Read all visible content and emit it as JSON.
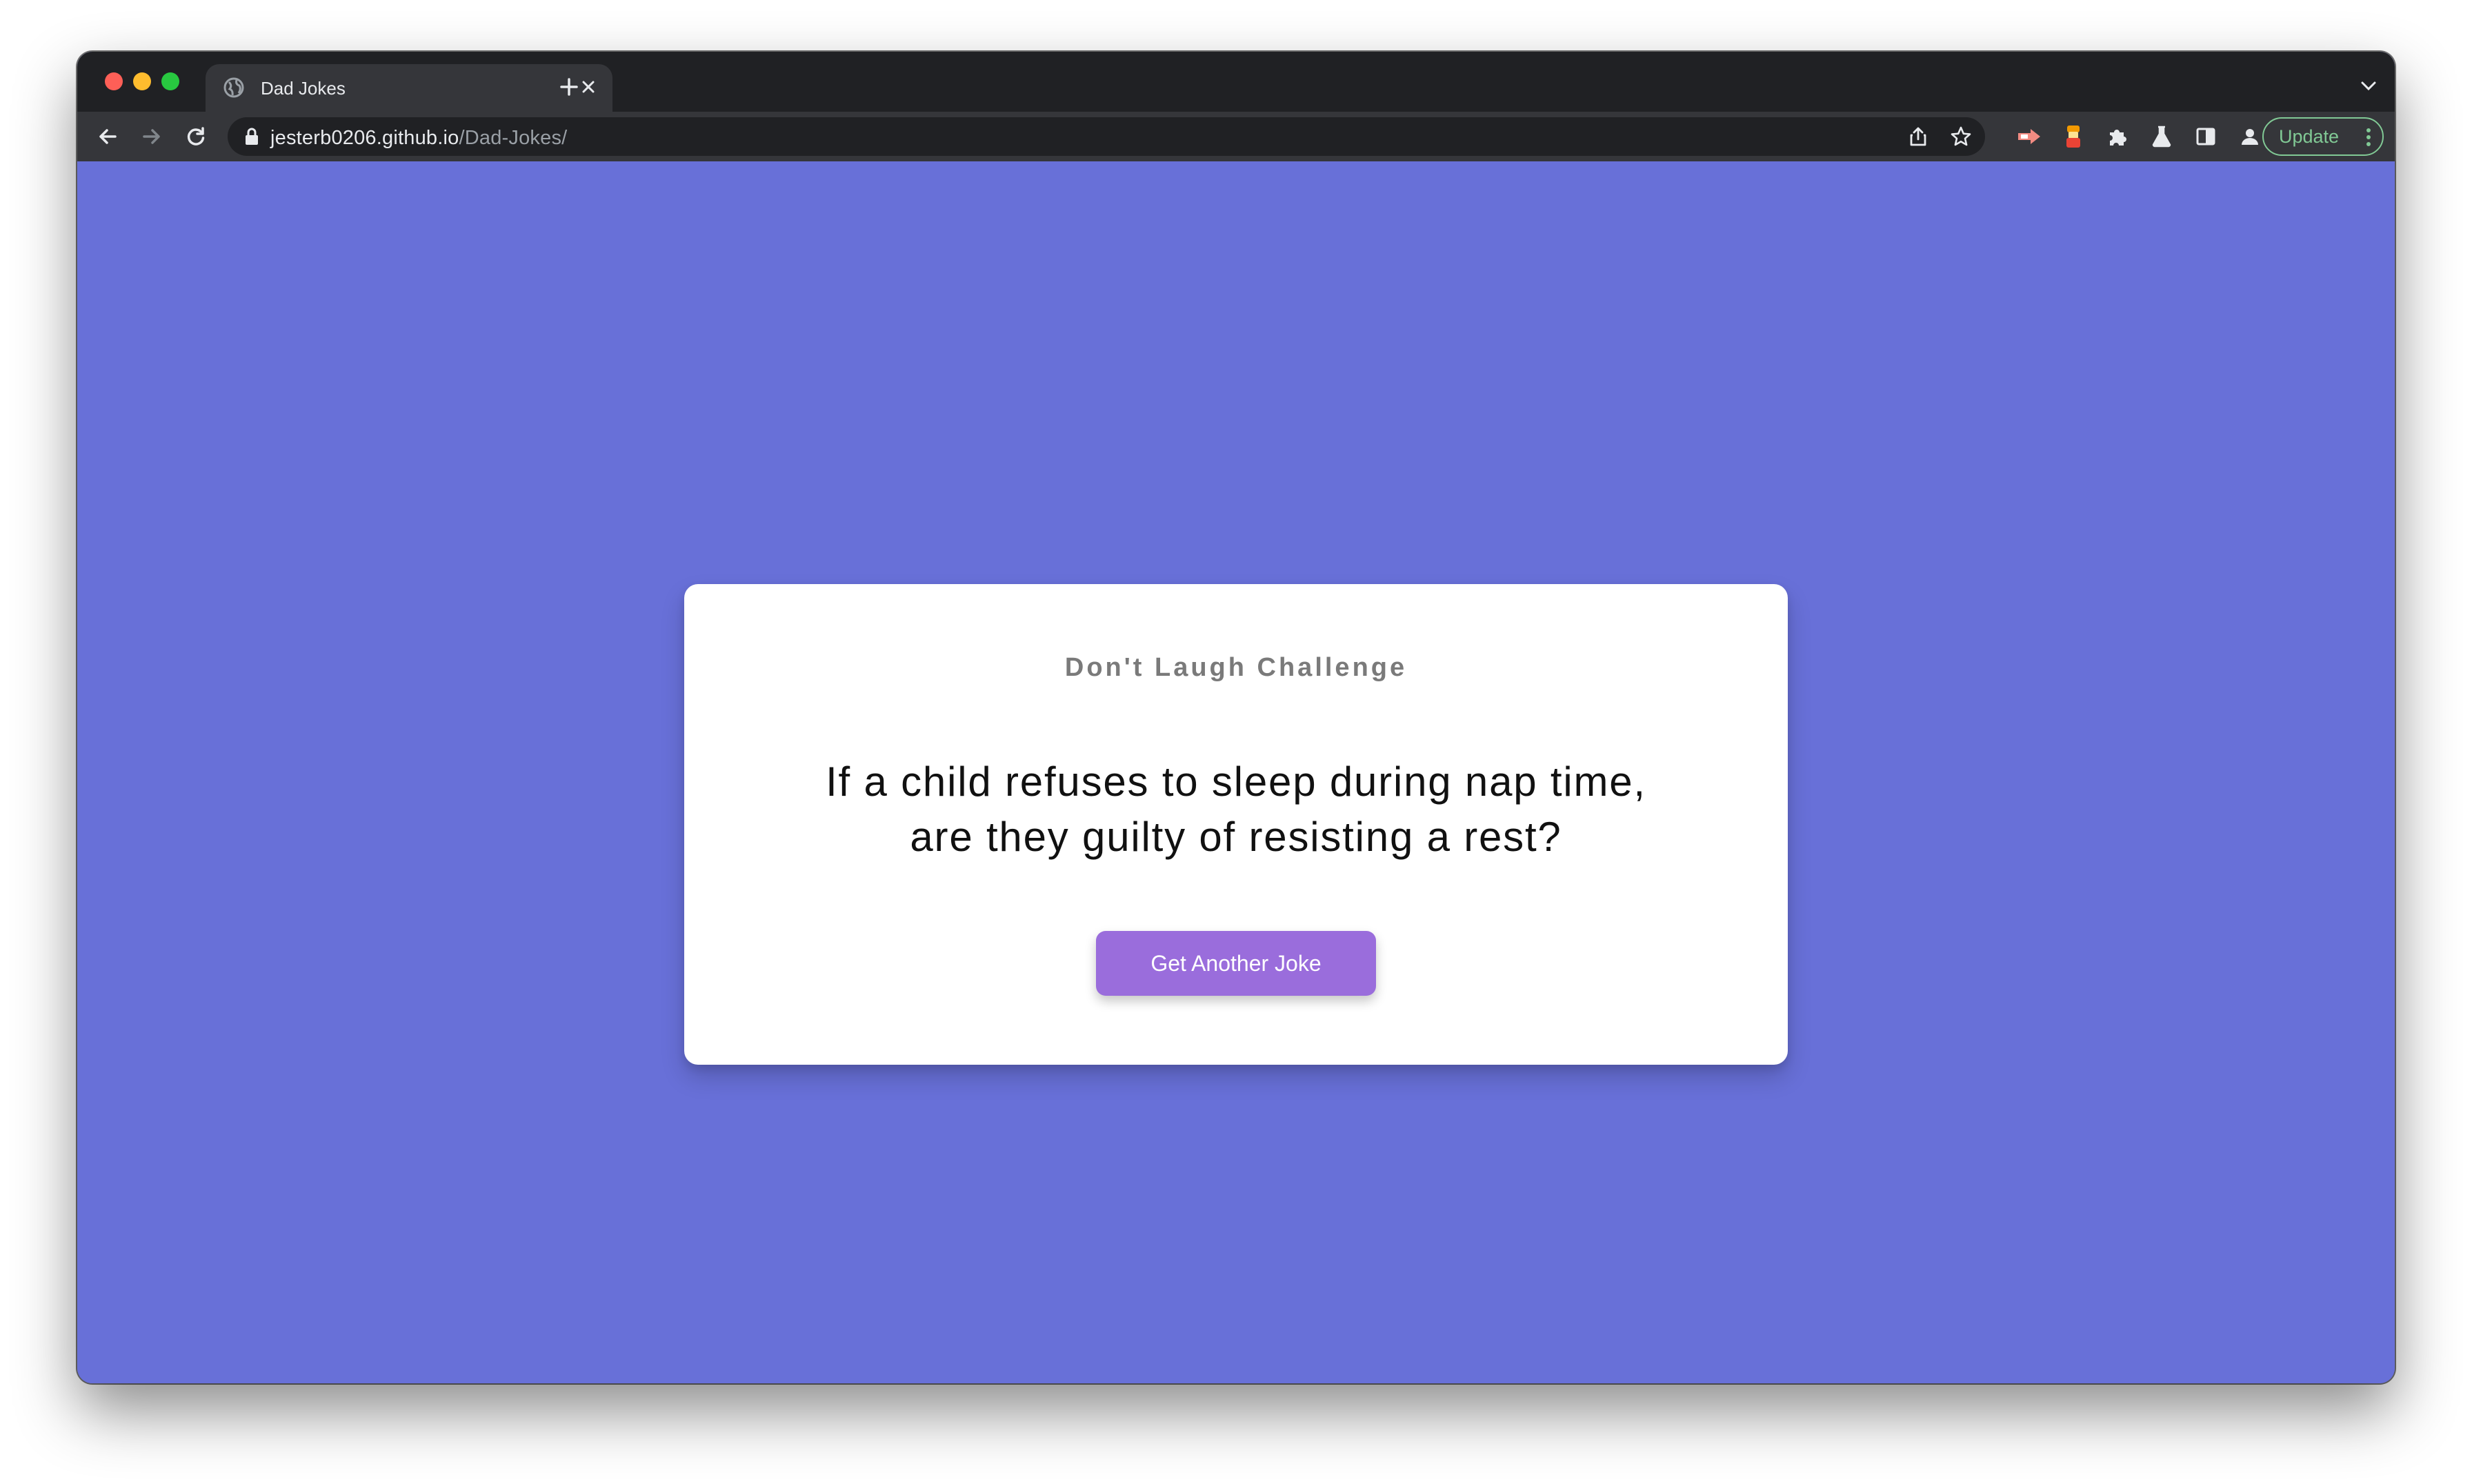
{
  "browser": {
    "tab": {
      "title": "Dad Jokes"
    },
    "address_bar": {
      "host": "jesterb0206.github.io",
      "path": "/Dad-Jokes/"
    },
    "update_label": "Update"
  },
  "card": {
    "heading": "Don't Laugh Challenge",
    "joke_line1": "If a child refuses to sleep during nap time,",
    "joke_line2": "are they guilty of resisting a rest?",
    "button_label": "Get Another Joke"
  },
  "colors": {
    "page_background": "#6870d8",
    "card_background": "#ffffff",
    "button_background": "#9a6ddc",
    "heading_text": "#7a7a7a"
  }
}
